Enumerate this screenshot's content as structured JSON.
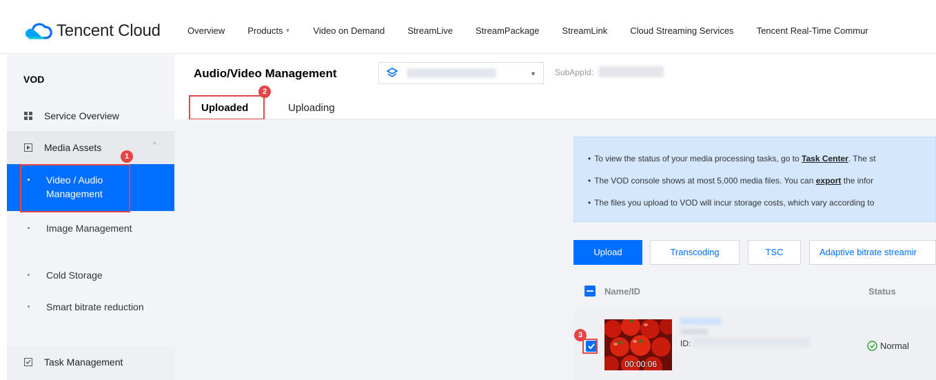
{
  "topbar": {
    "brand": "Tencent Cloud",
    "nav": [
      {
        "label": "Overview",
        "dropdown": false
      },
      {
        "label": "Products",
        "dropdown": true
      },
      {
        "label": "Video on Demand",
        "dropdown": false
      },
      {
        "label": "StreamLive",
        "dropdown": false
      },
      {
        "label": "StreamPackage",
        "dropdown": false
      },
      {
        "label": "StreamLink",
        "dropdown": false
      },
      {
        "label": "Cloud Streaming Services",
        "dropdown": false
      },
      {
        "label": "Tencent Real-Time Commur",
        "dropdown": false
      }
    ]
  },
  "sidebar": {
    "title": "VOD",
    "service_overview": "Service Overview",
    "media_assets": "Media Assets",
    "sub_items": [
      "Video / Audio Management",
      "Image Management",
      "Cold Storage",
      "Smart bitrate reduction"
    ],
    "task_management": "Task Management"
  },
  "header": {
    "title": "Audio/Video Management",
    "subappid_label": "SubAppId:"
  },
  "tabs": [
    "Uploaded",
    "Uploading"
  ],
  "info": {
    "line1_pre": "To view the status of your media processing tasks, go to ",
    "line1_link": "Task Center",
    "line1_post": ". The st",
    "line2_pre": "The VOD console shows at most 5,000 media files. You can ",
    "line2_link": "export",
    "line2_post": " the infor",
    "line3": "The files you upload to VOD will incur storage costs, which vary according to"
  },
  "toolbar": {
    "upload": "Upload",
    "transcoding": "Transcoding",
    "tsc": "TSC",
    "adaptive": "Adaptive bitrate streamir"
  },
  "table": {
    "col_name": "Name/ID",
    "col_status": "Status",
    "rows": [
      {
        "id_prefix": "ID:",
        "duration": "00:00:06",
        "status": "Normal"
      }
    ]
  },
  "annotations": [
    "1",
    "2",
    "3"
  ],
  "colors": {
    "accent": "#006eff",
    "marker": "#e54545",
    "sidebar_bg": "#f3f4f7",
    "success": "#29a329"
  }
}
